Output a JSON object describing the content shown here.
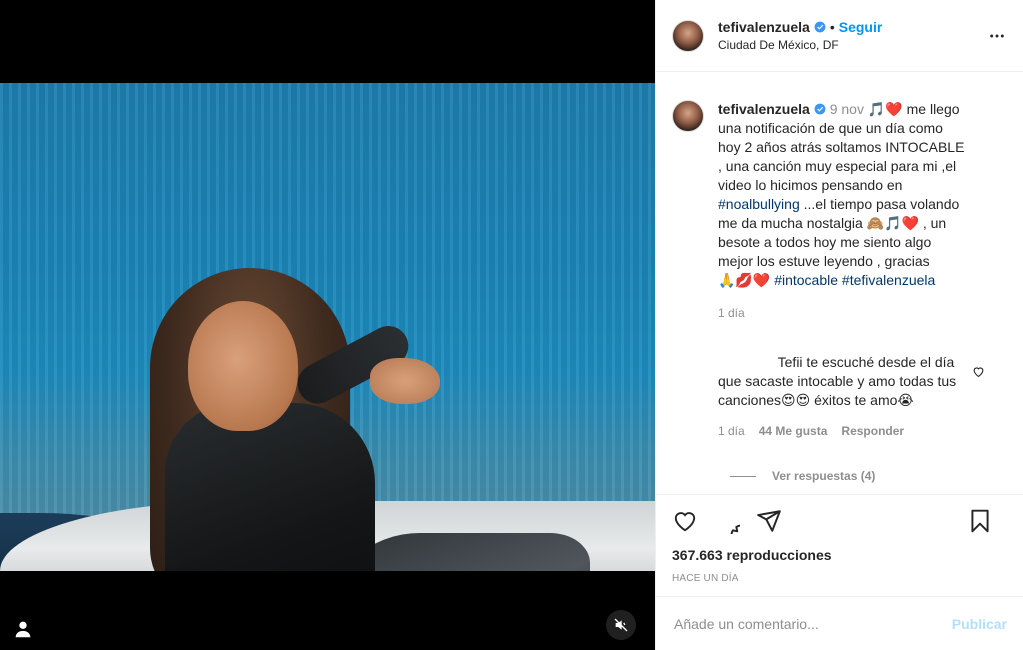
{
  "post": {
    "username": "tefivalenzuela",
    "follow_label": "Seguir",
    "separator": "•",
    "location": "Ciudad De México, DF"
  },
  "caption": {
    "username": "tefivalenzuela",
    "date": "9 nov",
    "emoji_1": "🎵❤️",
    "text_1": " me llego una notificación de que un día como hoy 2 años atrás soltamos INTOCABLE , una canción muy especial para mi ,el video lo hicimos pensando en ",
    "hashtag_1": "#noalbullying",
    "text_2": " ...el tiempo pasa volando me da mucha nostalgia ",
    "emoji_2": "🙈🎵❤️",
    "text_3": " , un besote a todos hoy me siento algo mejor los estuve leyendo , gracias ",
    "emoji_3": "🙏💋❤️",
    "hashtag_2": "#intocable",
    "hashtag_3": "#tefivalenzuela",
    "time": "1 día"
  },
  "comment": {
    "text": "Tefii te escuché desde el día que sacaste intocable y amo todas tus canciones",
    "emoji_1": "😍😍",
    "text_2": " éxitos te amo",
    "emoji_2": "😭",
    "time": "1 día",
    "likes": "44 Me gusta",
    "reply_label": "Responder",
    "view_replies": "Ver respuestas (4)"
  },
  "stats": {
    "views": "367.663 reproducciones",
    "when": "HACE UN DÍA"
  },
  "composer": {
    "placeholder": "Añade un comentario...",
    "publish_label": "Publicar"
  },
  "colors": {
    "accent": "#0095f6",
    "publish_disabled": "#b2dffc",
    "muted": "#8e8e8e",
    "hashtag": "#00376b"
  },
  "icons": {
    "more": "more-horizontal-icon",
    "verified": "verified-badge-icon",
    "like": "heart-icon",
    "comment": "comment-icon",
    "share": "share-icon",
    "save": "bookmark-icon",
    "mute": "mute-icon",
    "user": "user-tag-icon"
  }
}
